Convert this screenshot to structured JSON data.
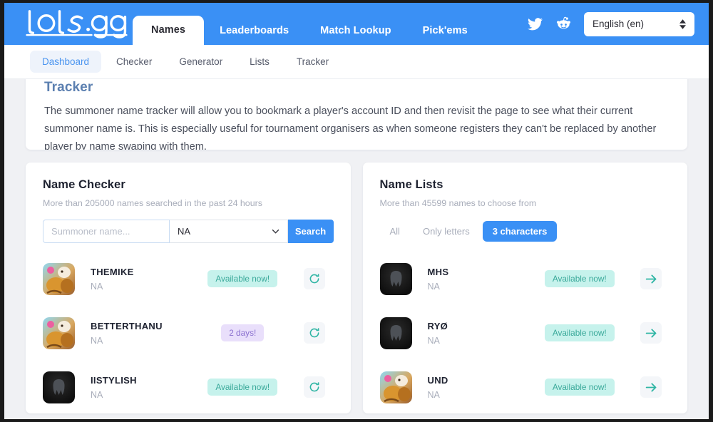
{
  "brand": {
    "logo_text": "lols.gg"
  },
  "topnav": {
    "tabs": [
      {
        "label": "Names",
        "active": true
      },
      {
        "label": "Leaderboards",
        "active": false
      },
      {
        "label": "Match Lookup",
        "active": false
      },
      {
        "label": "Pick'ems",
        "active": false
      }
    ],
    "social": [
      {
        "name": "twitter-icon"
      },
      {
        "name": "reddit-icon"
      }
    ],
    "language": {
      "value": "English (en)"
    },
    "bar_color": "#3a90f5"
  },
  "subnav": {
    "items": [
      {
        "label": "Dashboard",
        "active": true
      },
      {
        "label": "Checker",
        "active": false
      },
      {
        "label": "Generator",
        "active": false
      },
      {
        "label": "Lists",
        "active": false
      },
      {
        "label": "Tracker",
        "active": false
      }
    ]
  },
  "intro": {
    "title": "Tracker",
    "body": "The summoner name tracker will allow you to bookmark a player's account ID and then revisit the page to see what their current summoner name is. This is especially useful for tournament organisers as when someone registers they can't be replaced by another player by name swaping with them."
  },
  "name_checker": {
    "title": "Name Checker",
    "subtitle": "More than 205000 names searched in the past 24 hours",
    "search_placeholder": "Summoner name...",
    "search_value": "",
    "region_value": "NA",
    "search_button": "Search",
    "rows": [
      {
        "name": "THEMIKE",
        "region": "NA",
        "status": "Available now!",
        "status_kind": "avail",
        "icon": "poro-thumb",
        "action": "refresh-icon"
      },
      {
        "name": "BETTERTHANU",
        "region": "NA",
        "status": "2 days!",
        "status_kind": "days",
        "icon": "poro-thumb",
        "action": "refresh-icon"
      },
      {
        "name": "IISTYLISH",
        "region": "NA",
        "status": "Available now!",
        "status_kind": "avail",
        "icon": "helmet-thumb",
        "action": "refresh-icon"
      }
    ]
  },
  "name_lists": {
    "title": "Name Lists",
    "subtitle": "More than 45599 names to choose from",
    "filters": [
      {
        "label": "All",
        "active": false
      },
      {
        "label": "Only letters",
        "active": false
      },
      {
        "label": "3 characters",
        "active": true
      }
    ],
    "rows": [
      {
        "name": "MHS",
        "region": "NA",
        "status": "Available now!",
        "status_kind": "avail",
        "icon": "helmet-thumb",
        "action": "arrow-right-icon"
      },
      {
        "name": "RYØ",
        "region": "NA",
        "status": "Available now!",
        "status_kind": "avail",
        "icon": "helmet-thumb",
        "action": "arrow-right-icon"
      },
      {
        "name": "UND",
        "region": "NA",
        "status": "Available now!",
        "status_kind": "avail",
        "icon": "poro-thumb",
        "action": "arrow-right-icon"
      }
    ]
  },
  "colors": {
    "brand_blue": "#3a90f5",
    "page_bg": "#f0f1f4",
    "badge_available_bg": "#c6f2ec",
    "badge_available_fg": "#3aa99a",
    "badge_days_bg": "#e9dffb",
    "badge_days_fg": "#8a6fcf",
    "teal_action": "#2fb5a4"
  }
}
